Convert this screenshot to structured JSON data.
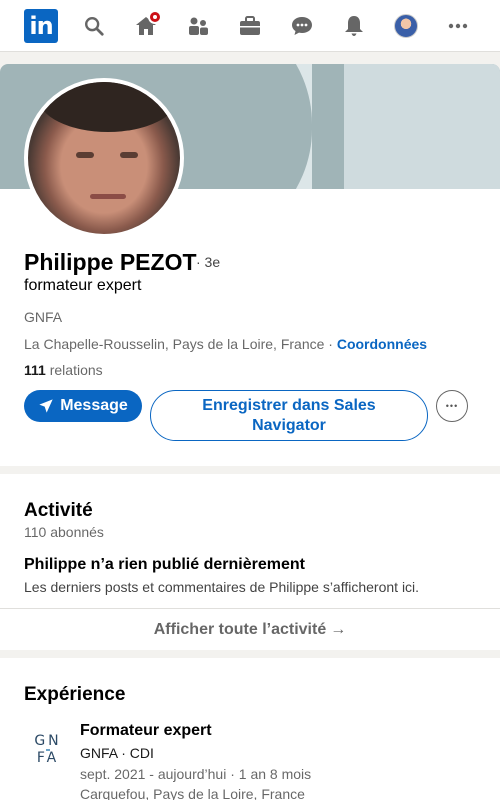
{
  "nav": {
    "logo_text": "in",
    "items": [
      {
        "name": "search-icon"
      },
      {
        "name": "home-icon",
        "badge": true
      },
      {
        "name": "network-icon"
      },
      {
        "name": "jobs-icon"
      },
      {
        "name": "messaging-icon"
      },
      {
        "name": "notifications-icon"
      },
      {
        "name": "me-avatar"
      },
      {
        "name": "more-icon"
      }
    ]
  },
  "profile": {
    "name": "Philippe PEZOT",
    "degree": "· 3e",
    "headline": "formateur expert",
    "company": "GNFA",
    "location": "La Chapelle-Rousselin, Pays de la Loire, France",
    "location_sep": " · ",
    "contact_link": "Coordonnées",
    "relations_count": "111",
    "relations_label": " relations",
    "message_button": "Message",
    "sales_button": "Enregistrer dans Sales Navigator",
    "more_button": "•••"
  },
  "activity": {
    "title": "Activité",
    "followers": "110 abonnés",
    "empty_title": "Philippe n’a rien publié dernièrement",
    "empty_desc": "Les derniers posts et commentaires de Philippe s’afficheront ici.",
    "show_all": "Afficher toute l’activité",
    "show_all_arrow": "→"
  },
  "experience": {
    "title": "Expérience",
    "items": [
      {
        "logo_top": "GN",
        "logo_bottom": "FA",
        "title": "Formateur expert",
        "company": "GNFA · CDI",
        "dates": "sept. 2021 - aujourd’hui · 1 an 8 mois",
        "location": "Carquefou, Pays de la Loire, France"
      }
    ]
  },
  "colors": {
    "brand": "#0a66c2",
    "badge": "#cc1016",
    "banner": "#a0b4b7"
  }
}
